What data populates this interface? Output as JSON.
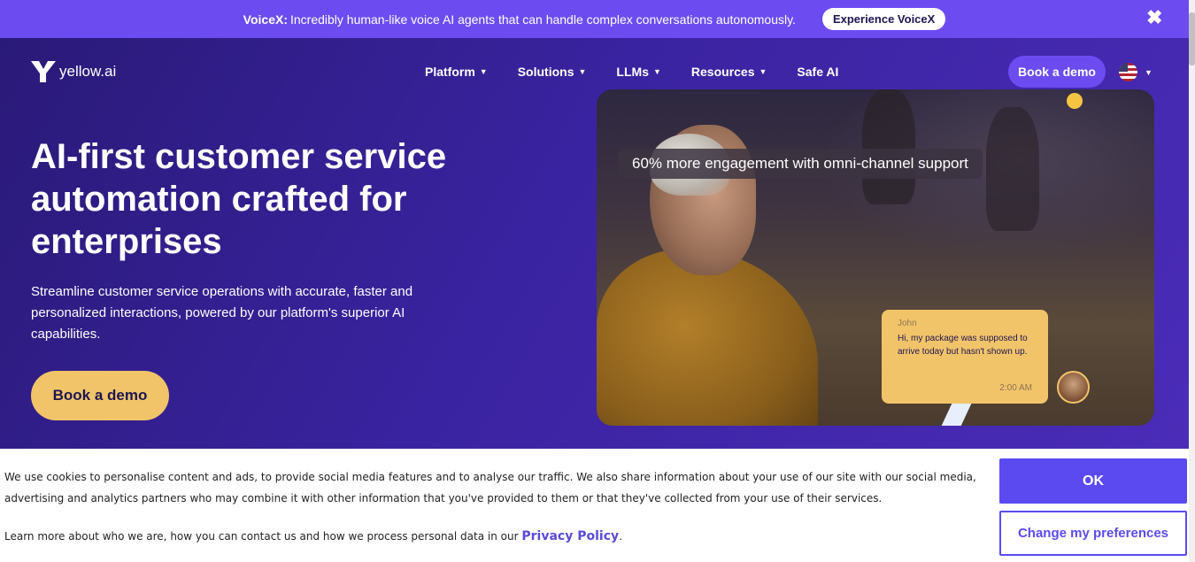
{
  "announcement": {
    "lead": "VoiceX:",
    "message": "Incredibly human-like voice AI agents that can handle complex conversations autonomously.",
    "cta": "Experience VoiceX",
    "close_icon": "✖"
  },
  "nav": {
    "logo_text": "yellow.ai",
    "items": [
      {
        "label": "Platform",
        "has_dropdown": true
      },
      {
        "label": "Solutions",
        "has_dropdown": true
      },
      {
        "label": "LLMs",
        "has_dropdown": true
      },
      {
        "label": "Resources",
        "has_dropdown": true
      },
      {
        "label": "Safe AI",
        "has_dropdown": false
      }
    ],
    "cta": "Book a demo",
    "language_icon": "us-flag-icon"
  },
  "hero": {
    "headline": "AI-first customer service automation crafted for enterprises",
    "subtext": "Streamline customer service operations with accurate, faster and personalized interactions, powered by our platform's superior AI capabilities.",
    "cta": "Book a demo"
  },
  "media": {
    "badge": "60% more engagement with omni-channel support",
    "chat": {
      "sender": "John",
      "message": "Hi, my package was supposed to arrive today but hasn't shown up.",
      "time": "2:00 AM"
    }
  },
  "cookie": {
    "text": "We use cookies to personalise content and ads, to provide social media features and to analyse our traffic. We also share information about your use of our site with our social media, advertising and analytics partners who may combine it with other information that you've provided to them or that they've collected from your use of their services.",
    "learn_more": "Learn more about who we are, how you can contact us and how we process personal data in our",
    "privacy_link": "Privacy Policy",
    "period": ".",
    "ok": "OK",
    "preferences": "Change my preferences"
  },
  "colors": {
    "accent": "#6c4cf1",
    "hero_bg": "#3a23a0",
    "cta_yellow": "#f2c46a"
  }
}
